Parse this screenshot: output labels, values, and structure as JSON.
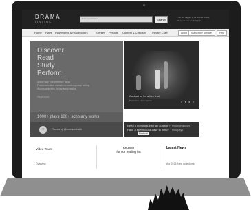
{
  "logo": {
    "top": "DRAMA",
    "bottom": "ONLINE"
  },
  "search": {
    "placeholder": "Enter search term",
    "button": "Search"
  },
  "account": {
    "line1": "You are logged in as Drama Online",
    "line2": "Not your account? Sign in"
  },
  "nav": {
    "items": [
      "Home",
      "Plays",
      "Playwrights & Practitioners",
      "Genres",
      "Periods",
      "Context & Criticism",
      "Theatre Craft"
    ],
    "buttons": [
      "About",
      "Subscriber Services",
      "Help"
    ]
  },
  "hero": {
    "title_lines": [
      "Discover",
      "Read",
      "Study",
      "Perform"
    ],
    "desc_lines": [
      "A new way to experience plays",
      "From curriculum classics to contemporary writing",
      "Accompanied by theory and practice"
    ],
    "read_more": "Read more",
    "tagline": "1000+ plays 100+ scholarly works",
    "contact": "Contact us for a free trial",
    "caption": "Production photo caption"
  },
  "twitter": {
    "text": "Tweets by @dramaonlinelib"
  },
  "monologue": {
    "line1": "Need a monologue for an audition?",
    "line2": "Have a specific use-case in mind?",
    "button": "Find out",
    "find_monologues": "Find monologues",
    "find_plays": "Find plays"
  },
  "columns": {
    "video_tours": "Video Tours",
    "overview": "Overview",
    "register_line1": "Register",
    "register_line2": "for our mailing list",
    "latest_news": "Latest News",
    "news_item": "Apr 2015: New collections"
  }
}
